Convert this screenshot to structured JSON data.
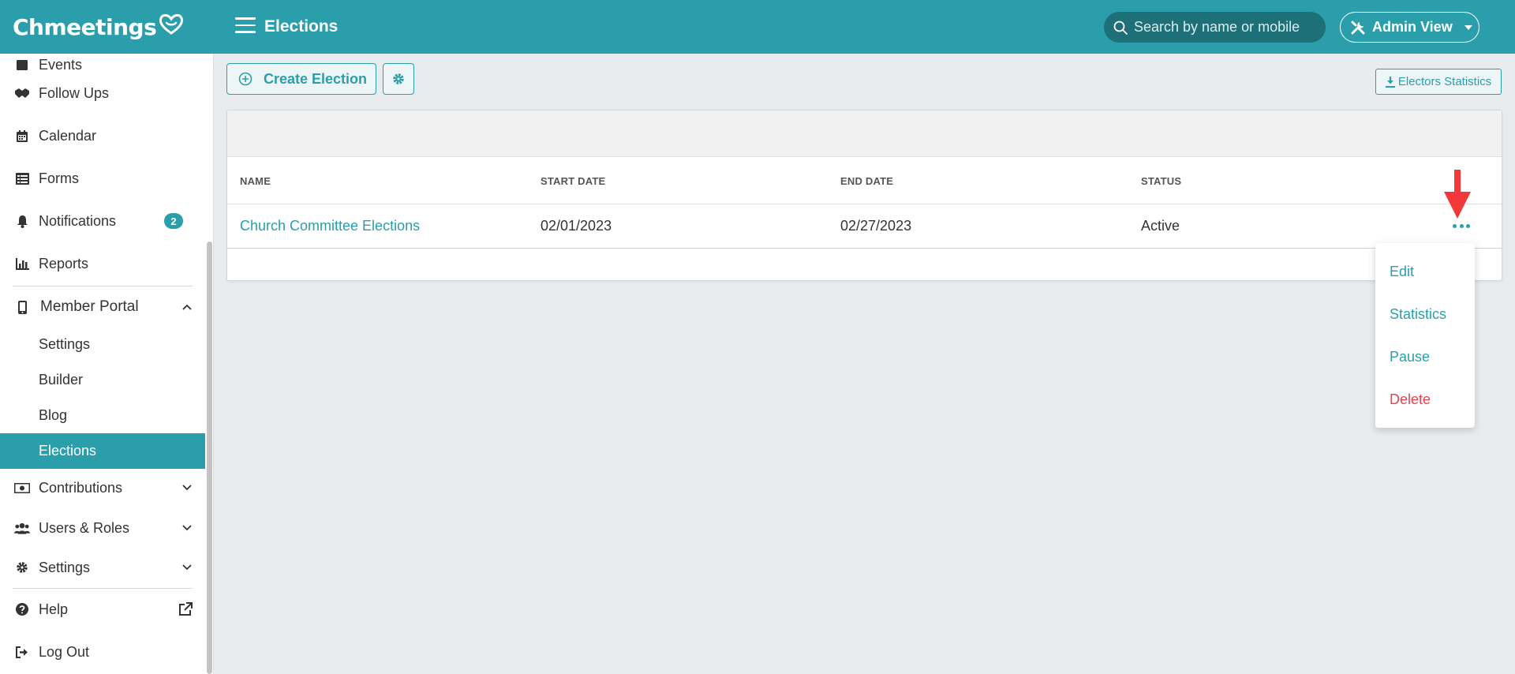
{
  "header": {
    "logo_text": "Chmeetings",
    "page_title": "Elections",
    "search_placeholder": "Search by name or mobile",
    "admin_view_label": "Admin View"
  },
  "sidebar": {
    "items": [
      {
        "label": "Events",
        "icon": "calendar-check-icon"
      },
      {
        "label": "Follow Ups",
        "icon": "handshake-icon"
      },
      {
        "label": "Calendar",
        "icon": "calendar-icon"
      },
      {
        "label": "Forms",
        "icon": "list-icon"
      },
      {
        "label": "Notifications",
        "icon": "bell-icon",
        "badge": "2"
      },
      {
        "label": "Reports",
        "icon": "chart-icon"
      },
      {
        "label": "Member Portal",
        "icon": "mobile-icon"
      },
      {
        "label": "Contributions",
        "icon": "money-icon"
      },
      {
        "label": "Users & Roles",
        "icon": "users-icon"
      },
      {
        "label": "Settings",
        "icon": "gear-icon"
      },
      {
        "label": "Help",
        "icon": "question-circle-icon"
      },
      {
        "label": "Log Out",
        "icon": "logout-icon"
      }
    ],
    "member_portal_children": [
      "Settings",
      "Builder",
      "Blog",
      "Elections"
    ],
    "active_item": "Elections"
  },
  "toolbar": {
    "create_label": "Create Election",
    "electors_statistics_label": "Electors Statistics"
  },
  "table": {
    "columns": [
      "NAME",
      "START DATE",
      "END DATE",
      "STATUS"
    ],
    "rows": [
      {
        "name": "Church Committee Elections",
        "start_date": "02/01/2023",
        "end_date": "02/27/2023",
        "status": "Active"
      }
    ]
  },
  "row_menu": {
    "items": [
      {
        "label": "Edit"
      },
      {
        "label": "Statistics"
      },
      {
        "label": "Pause"
      },
      {
        "label": "Delete"
      }
    ]
  },
  "colors": {
    "brand": "#2a9fab",
    "danger": "#e8414f",
    "annotation_arrow": "#f2383a"
  }
}
